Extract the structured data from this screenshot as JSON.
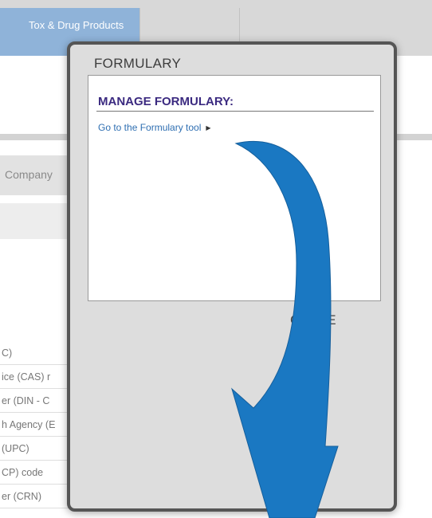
{
  "background": {
    "active_tab": "Tox & Drug Products",
    "company_label": "Company",
    "list_items": [
      "C)",
      "ice (CAS) r",
      "er (DIN - C",
      "h Agency (E",
      "(UPC)",
      "CP) code",
      "er (CRN)"
    ]
  },
  "modal": {
    "title": "FORMULARY",
    "section_heading": "MANAGE FORMULARY:",
    "link_text": "Go to the Formulary tool",
    "close_label": "CLOSE"
  },
  "colors": {
    "arrow": "#1a78c2",
    "heading": "#3b2a80",
    "link": "#2f6fb2"
  }
}
